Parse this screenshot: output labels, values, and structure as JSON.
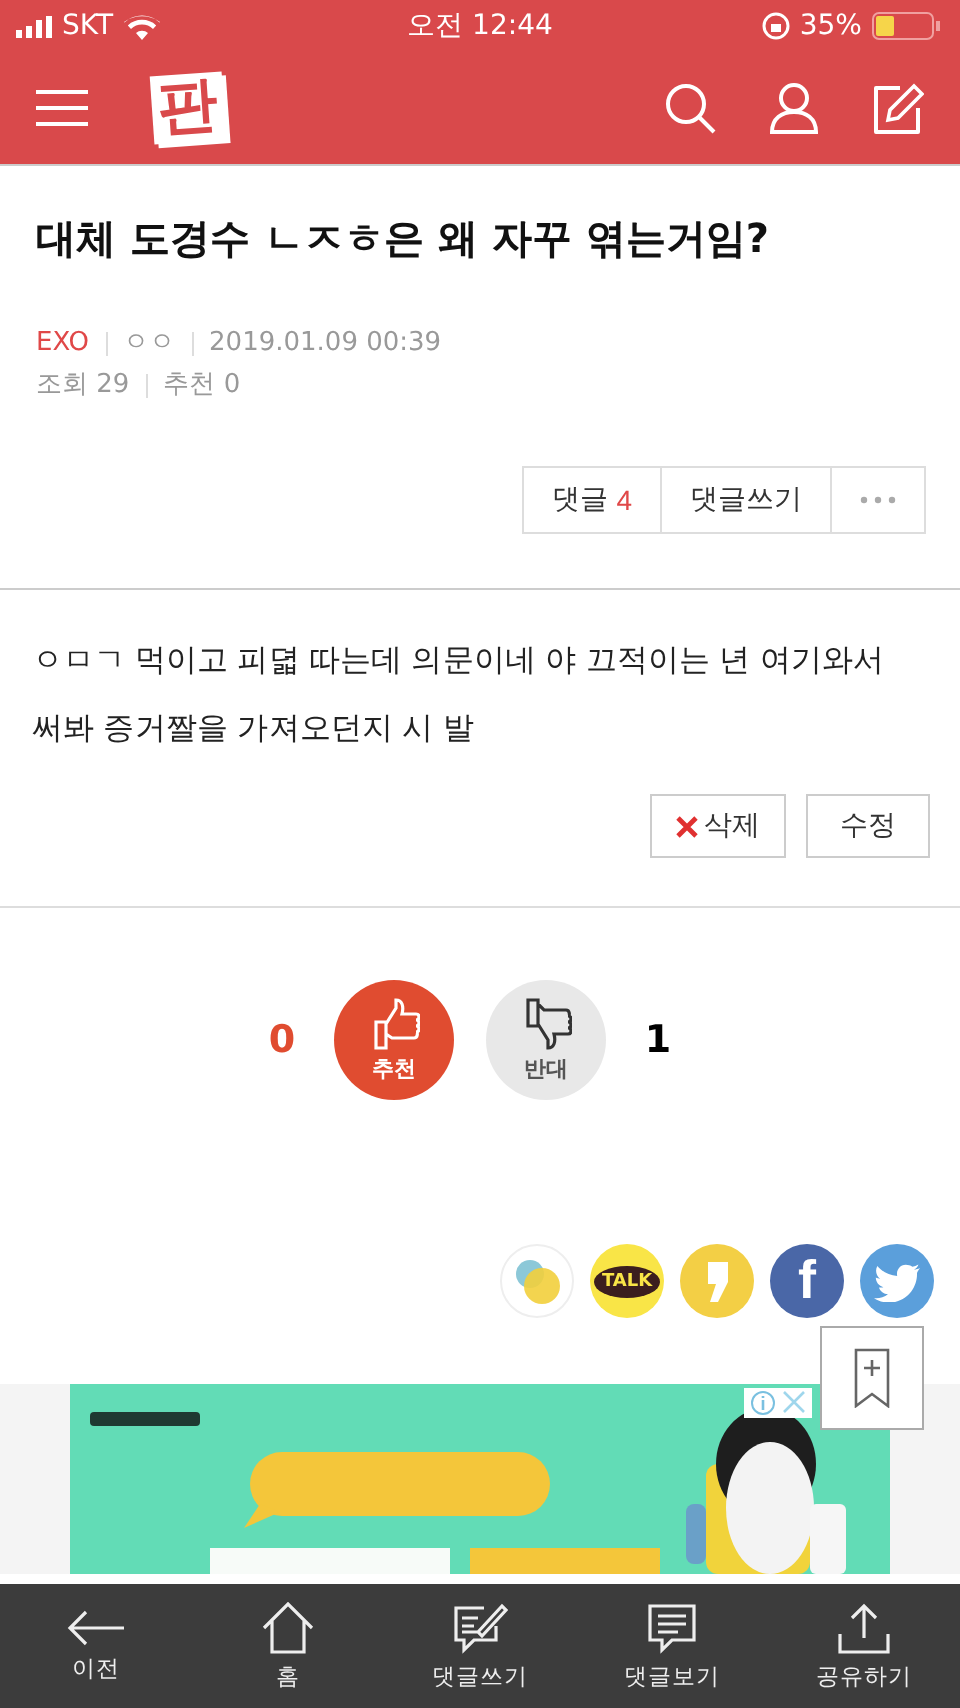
{
  "status_bar": {
    "carrier": "SKT",
    "time": "오전 12:44",
    "battery": "35%"
  },
  "header": {
    "logo": "판"
  },
  "post": {
    "title": "대체 도경수 ㄴㅈㅎ은 왜 자꾸 엮는거임?",
    "category": "EXO",
    "author": "ㅇㅇ",
    "date": "2019.01.09 00:39",
    "views": "조회 29",
    "recommends": "추천 0"
  },
  "actions": [
    {
      "kind": "comments",
      "label": "댓글",
      "count": "4"
    },
    {
      "kind": "write",
      "label": "댓글쓰기"
    },
    {
      "kind": "more"
    }
  ],
  "body": "ㅇㅁㄱ 먹이고 피뎗 따는데 의문이네 야 끄적이는 년 여기와서 써봐 증거짤을 가져오던지 시 발",
  "edit_buttons": [
    {
      "kind": "delete",
      "label": "삭제"
    },
    {
      "kind": "edit",
      "label": "수정"
    }
  ],
  "votes": {
    "up_count": "0",
    "up_label": "추천",
    "down_label": "반대",
    "down_count": "1"
  },
  "share": [
    {
      "kind": "bubbles"
    },
    {
      "kind": "talk",
      "label": "TALK"
    },
    {
      "kind": "comma"
    },
    {
      "kind": "letter",
      "label": "f"
    },
    {
      "kind": "bird"
    }
  ],
  "tab_bar": [
    {
      "kind": "back",
      "label": "이전"
    },
    {
      "kind": "home",
      "label": "홈"
    },
    {
      "kind": "write",
      "label": "댓글쓰기"
    },
    {
      "kind": "comments",
      "label": "댓글보기"
    },
    {
      "kind": "share",
      "label": "공유하기"
    }
  ]
}
